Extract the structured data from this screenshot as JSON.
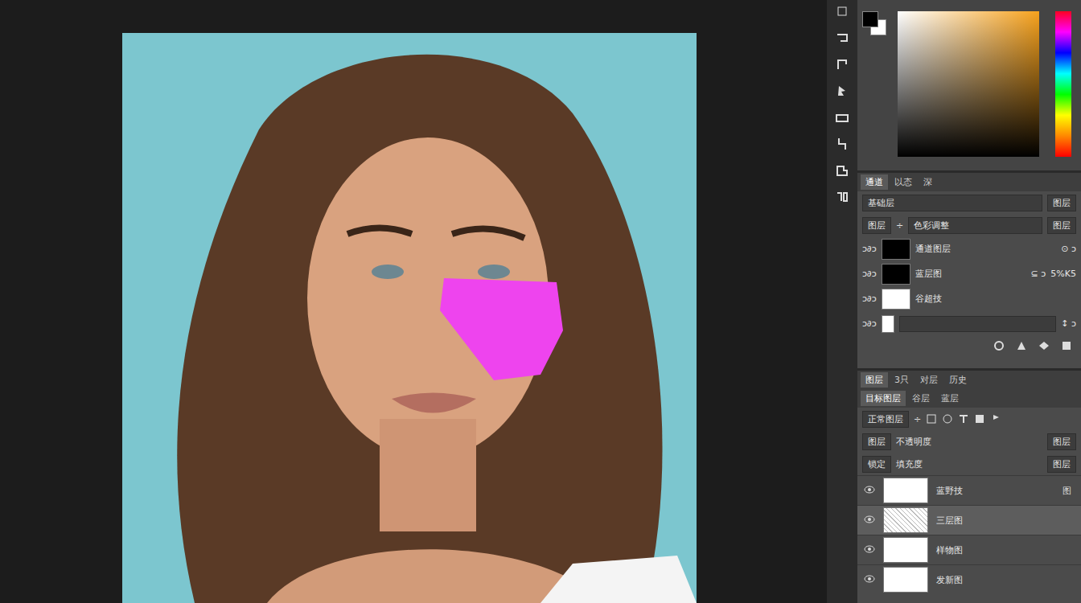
{
  "colors": {
    "foreground": "#000000",
    "background": "#ffffff"
  },
  "panel1": {
    "tabs": [
      {
        "label": "通道",
        "selected": true
      },
      {
        "label": "以态",
        "selected": false
      },
      {
        "label": "深",
        "selected": false
      }
    ],
    "header": "基础层",
    "header_button": "图层",
    "adjust": {
      "mode": "图层",
      "mode_arrow": "÷",
      "preset": "色彩调整",
      "button": "图层"
    },
    "layers": [
      {
        "prefix": "ↄ∂ↄ",
        "thumb": "#000000",
        "name": "通道图层",
        "suffix": "⊙ ↄ",
        "extra": ""
      },
      {
        "prefix": "ↄ∂ↄ",
        "thumb": "#000000",
        "name": "蓝层图",
        "suffix": "⊆ ↄ",
        "extra": "5%K5"
      },
      {
        "prefix": "ↄ∂ↄ",
        "thumb": "#ffffff",
        "name": "谷超技",
        "suffix": "",
        "extra": ""
      },
      {
        "prefix": "ↄ∂ↄ",
        "thumb": "#ffffff",
        "name": "",
        "suffix": "↕ ↄ",
        "extra": ""
      }
    ]
  },
  "panel2": {
    "tabs": [
      {
        "label": "图层",
        "selected": true
      },
      {
        "label": "3只",
        "selected": false
      },
      {
        "label": "对层",
        "selected": false
      },
      {
        "label": "历史",
        "selected": false
      }
    ],
    "subtabs": [
      {
        "label": "目标图层",
        "selected": true
      },
      {
        "label": "谷层",
        "selected": false
      },
      {
        "label": "蓝层",
        "selected": false
      }
    ],
    "blend": "正常图层",
    "blend_arrow": "÷",
    "opacity": {
      "label": "图层",
      "name": "不透明度",
      "value": "图层"
    },
    "fill": {
      "label": "锁定",
      "name": "填充度",
      "value": "图层"
    },
    "layers": [
      {
        "name": "蓝野技",
        "badge": "图",
        "selected": false
      },
      {
        "name": "三层图",
        "badge": "",
        "selected": true
      },
      {
        "name": "样物图",
        "badge": "",
        "selected": false
      },
      {
        "name": "发新图",
        "badge": "",
        "selected": false
      }
    ]
  }
}
